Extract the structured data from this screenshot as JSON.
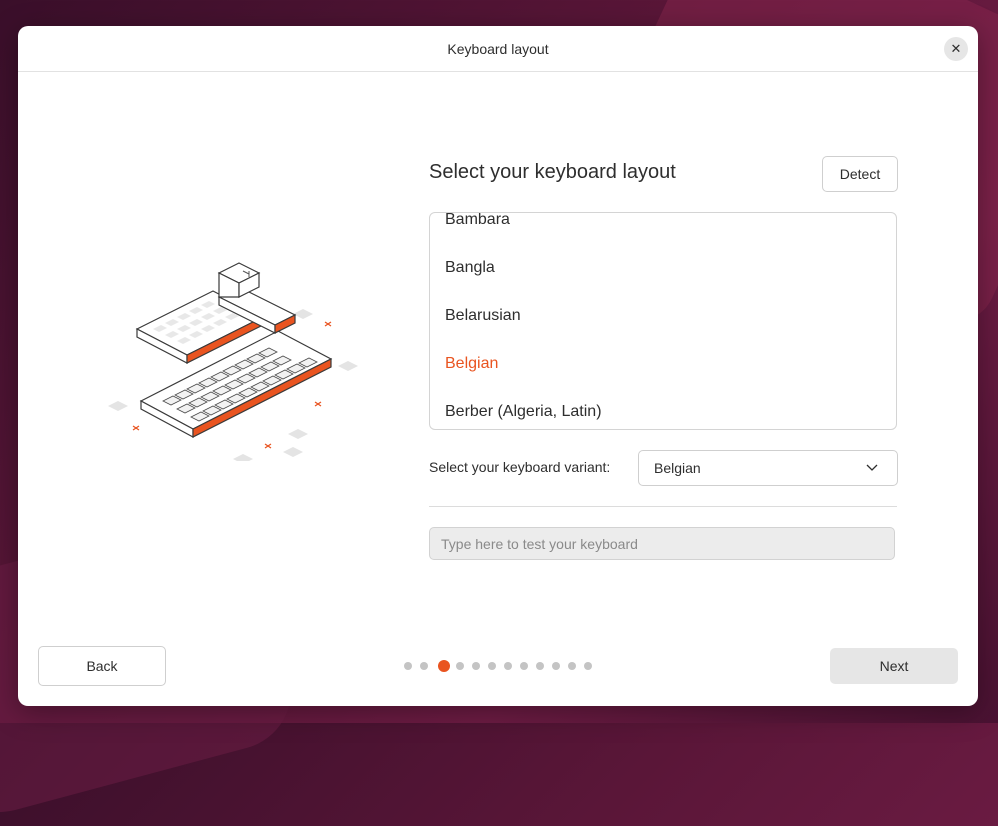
{
  "window": {
    "title": "Keyboard layout"
  },
  "heading": "Select your keyboard layout",
  "detect_label": "Detect",
  "layouts": {
    "items": [
      {
        "label": "Bambara",
        "selected": false
      },
      {
        "label": "Bangla",
        "selected": false
      },
      {
        "label": "Belarusian",
        "selected": false
      },
      {
        "label": "Belgian",
        "selected": true
      },
      {
        "label": "Berber (Algeria, Latin)",
        "selected": false
      }
    ]
  },
  "variant": {
    "label": "Select your keyboard variant:",
    "value": "Belgian"
  },
  "test_input": {
    "placeholder": "Type here to test your keyboard",
    "value": ""
  },
  "nav": {
    "back_label": "Back",
    "next_label": "Next"
  },
  "progress": {
    "total_steps": 12,
    "current_step": 3
  },
  "icons": {
    "close": "close-icon",
    "chevron": "chevron-down-icon"
  },
  "colors": {
    "accent": "#e95420"
  }
}
